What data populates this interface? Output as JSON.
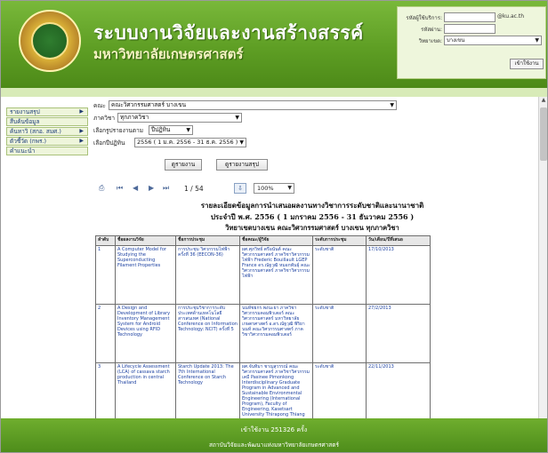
{
  "header": {
    "title": "ระบบงานวิจัยและงานสร้างสรรค์",
    "subtitle": "มหาวิทยาลัยเกษตรศาสตร์",
    "login": {
      "account_label": "รหัสผู้ใช้บริการ:",
      "account_suffix": "@ku.ac.th",
      "password_label": "รหัสผ่าน:",
      "campus_label": "วิทยาเขต:",
      "campus_value": "บางเขน",
      "login_button": "เข้าใช้งาน"
    }
  },
  "sidebar": {
    "items": [
      {
        "label": "รายงานสรุป",
        "arrow": "▶"
      },
      {
        "label": "สืบค้นข้อมูล",
        "arrow": ""
      },
      {
        "label": "ค้นหาวิ (สกอ. สมศ.)",
        "arrow": "▶"
      },
      {
        "label": "ตัวชี้วัด (กพร.)",
        "arrow": "▶"
      },
      {
        "label": "คำแนะนำ",
        "arrow": ""
      }
    ]
  },
  "filters": {
    "faculty_label": "คณะ",
    "faculty_value": "คณะวิศวกรรมศาสตร์ บางเขน",
    "department_label": "ภาควิชา",
    "department_value": "ทุกภาควิชา",
    "report_type_label": "เลือกรูปรายงานตาม",
    "report_type_value": "ปีปฏิทิน",
    "year_label": "เลือกปีปฏิทิน",
    "year_value": "2556 ( 1 ม.ค. 2556 - 31 ธ.ค. 2556 )",
    "view_report_button": "ดูรายงาน",
    "summary_button": "ดูรายงานสรุป"
  },
  "toolbar": {
    "print_icon": "⎙",
    "first": "⏮",
    "prev": "◀",
    "next": "▶",
    "last": "⏭",
    "page_current": "1",
    "page_total": "54",
    "page_sep": "/",
    "export_icon": "⇩",
    "zoom": "100%"
  },
  "report": {
    "title_line1": "รายละเอียดข้อมูลการนำเสนอผลงานทางวิชาการระดับชาติและนานาชาติ",
    "title_line2": "ประจำปี พ.ศ. 2556 ( 1 มกราคม 2556 - 31 ธันวาคม 2556 )",
    "title_line3": "วิทยาเขตบางเขน คณะวิศวกรรมศาสตร์ บางเขน ทุกภาควิชา",
    "columns": [
      "ลำดับ",
      "ชื่อผลงานวิจัย",
      "ชื่อการประชุม",
      "ชื่อคณะ/ผู้วิจัย",
      "ระดับการประชุม",
      "วัน/เดือน/ปีที่เสนอ"
    ],
    "rows": [
      {
        "no": "1",
        "work": "A Computer Model for Studying the Superconducting Filament Properties",
        "conference": "การประชุม วิศวกรรมไฟฟ้า ครั้งที่ 36 (EECON-36)",
        "authors": "ผศ.ศุภวิทย์ ตรีอนันต์ คณะวิศวกรรมศาสตร์ ภาควิชาวิศวกรรมไฟฟ้า Frederic Bouillault LGEP France ดร.ณัฐวุฒิ หมอกพันธุ์ คณะวิศวกรรมศาสตร์ ภาควิชาวิศวกรรมไฟฟ้า",
        "level": "ระดับชาติ",
        "date": "17/10/2013"
      },
      {
        "no": "2",
        "work": "A Design and Development of Library Inventory Management System for Android Devices using RFID Technology",
        "conference": "การประชุมวิชาการระดับประเทศด้านเทคโนโลยีสารสนเทศ (National Conference on Information Technology: NCIT) ครั้งที่ 5",
        "authors": "นนท์ชยกร พงนะยา ภาควิชาวิศวกรรมคอมพิวเตอร์ คณะวิศวกรรมศาสตร์ มหาวิทยาลัยเกษตรศาสตร์ อ.ดร.ณัฐวุฒิ พิริยานนท์ คณะวิศวกรรมศาสตร์ ภาควิชาวิศวกรรมคอมพิวเตอร์",
        "level": "ระดับชาติ",
        "date": "27/2/2013"
      },
      {
        "no": "3",
        "work": "A Lifecycle Assessment (LCA) of cassava starch production in central Thailand",
        "conference": "Starch Update 2013: The 7th International Conference on Starch Technology",
        "authors": "ผศ.จันทิมา ชาญสุวรรณ์ คณะวิศวกรรมศาสตร์ ภาควิชาวิศวกรรมเคมี Pasinee Pimonkong Interdisciplinary Graduate Program in Advanced and Sustainable Environmental Engineering (International Program), Faculty of Engineering, Kasetsart University Thirapong Thiang",
        "level": "ระดับชาติ",
        "date": "22/11/2013"
      }
    ]
  },
  "footer": {
    "visits": "เข้าใช้งาน 251326 ครั้ง",
    "org": "สถาบันวิจัยและพัฒนาแห่งมหาวิทยาลัยเกษตรศาสตร์"
  },
  "colors": {
    "header_green": "#5e9e24",
    "footer_green": "#4e8d1b",
    "link_blue": "#1a3fa0"
  }
}
